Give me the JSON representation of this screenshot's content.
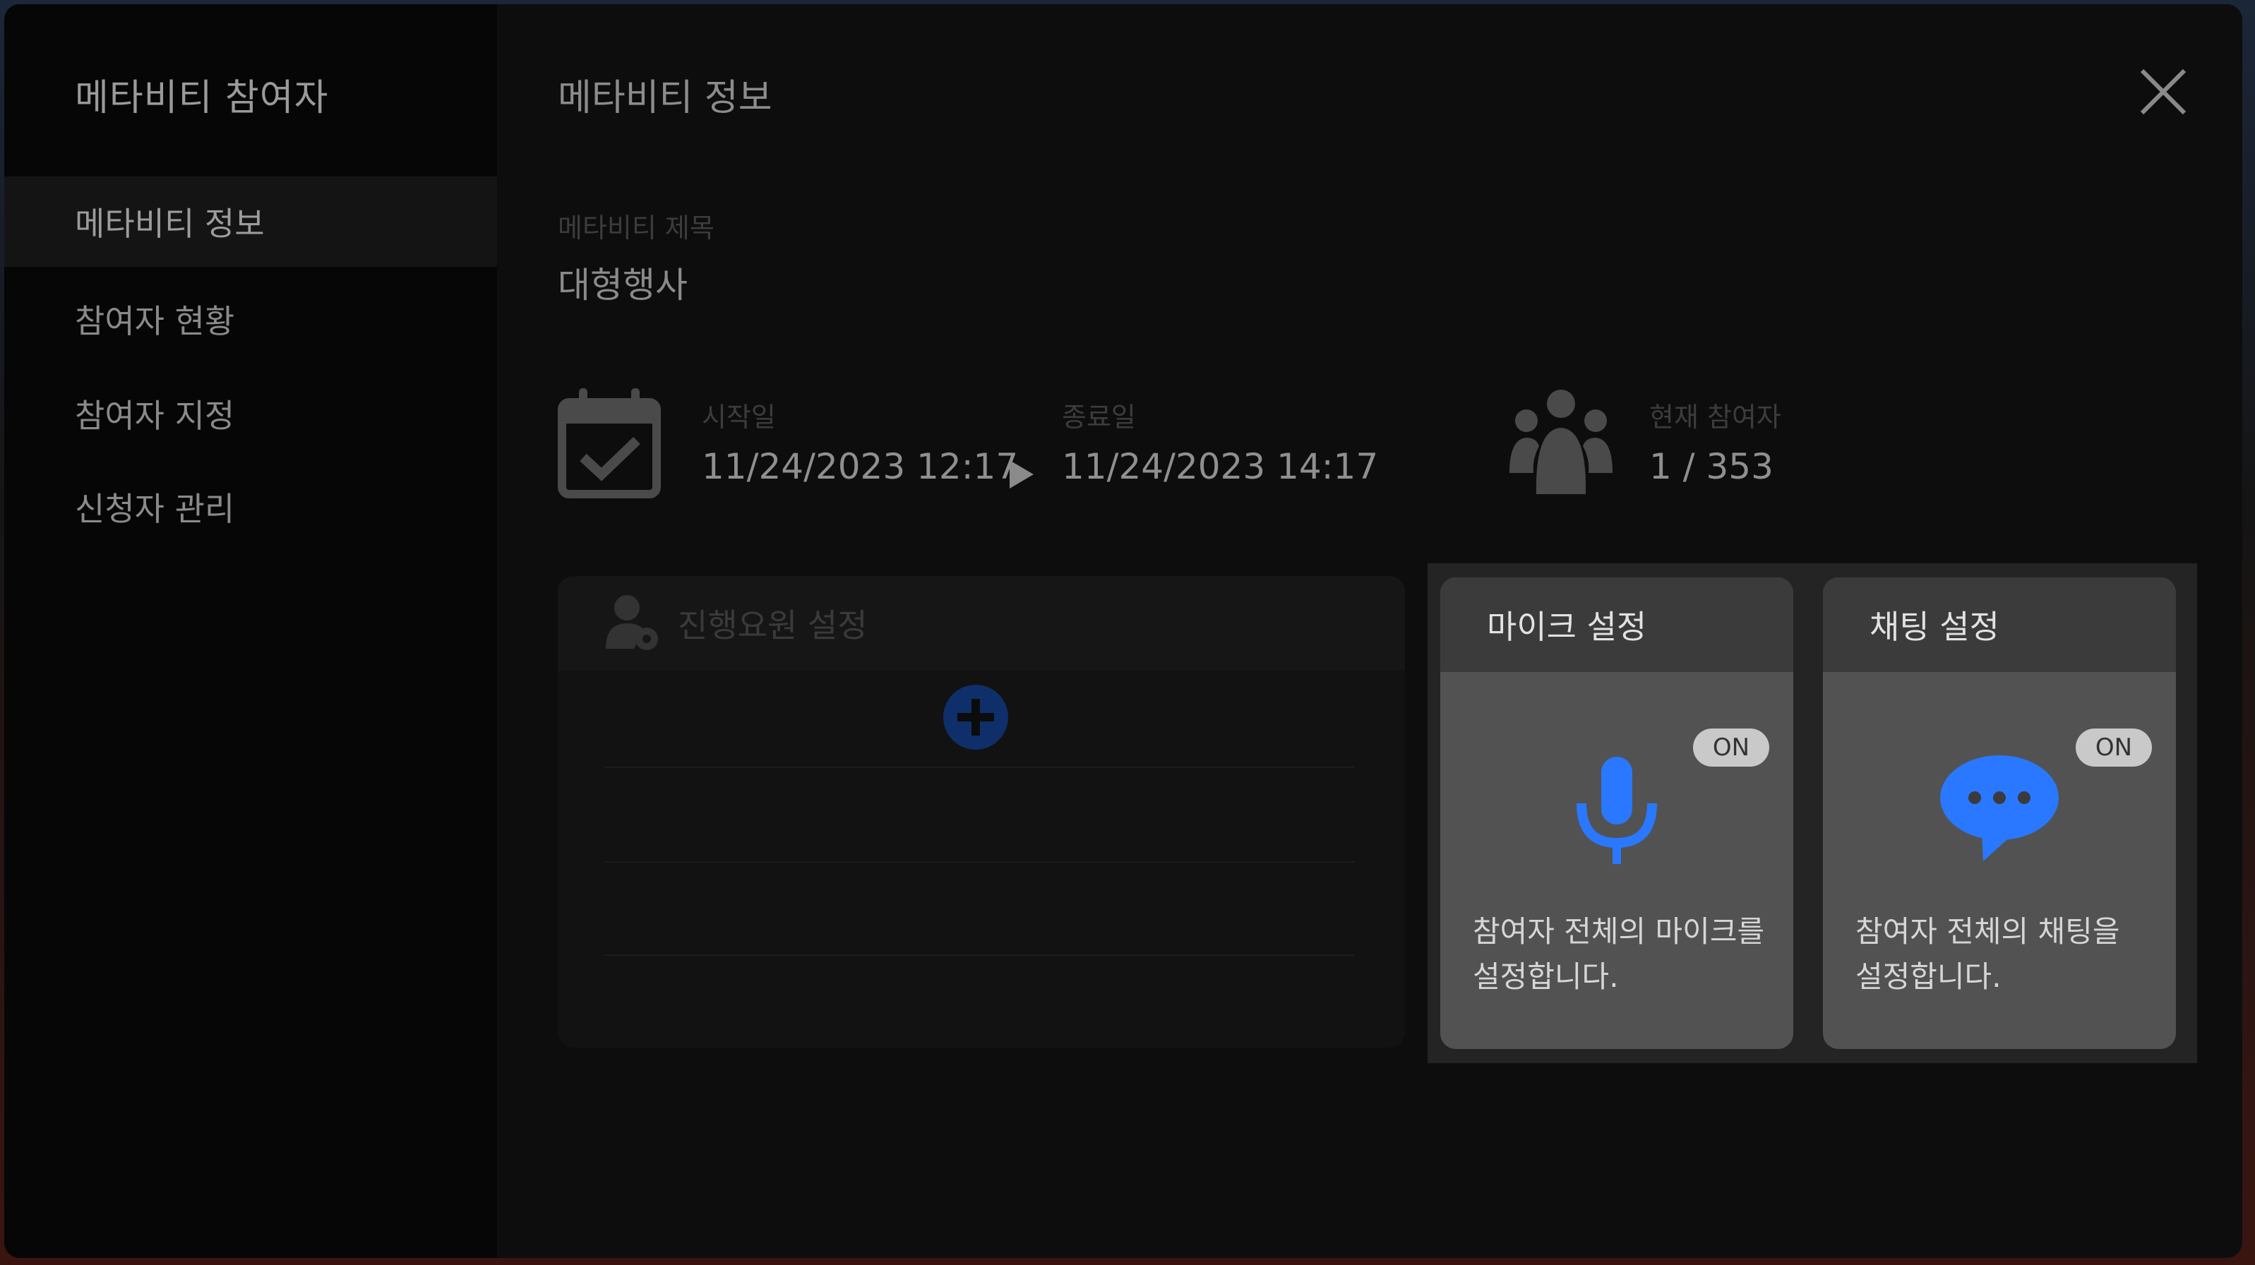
{
  "sidebar": {
    "title": "메타비티 참여자",
    "items": [
      {
        "label": "메타비티 정보",
        "active": true
      },
      {
        "label": "참여자 현황",
        "active": false
      },
      {
        "label": "참여자 지정",
        "active": false
      },
      {
        "label": "신청자 관리",
        "active": false
      }
    ]
  },
  "main": {
    "title": "메타비티 정보",
    "title_field": {
      "label": "메타비티 제목",
      "value": "대형행사"
    },
    "dates": {
      "start_label": "시작일",
      "start_value": "11/24/2023 12:17",
      "end_label": "종료일",
      "end_value": "11/24/2023 14:17",
      "icon": "calendar-check-icon"
    },
    "participants": {
      "label": "현재 참여자",
      "value": "1 / 353",
      "icon": "users-icon"
    },
    "staff_panel": {
      "label": "진행요원 설정",
      "icon": "user-gear-icon"
    },
    "mic_card": {
      "title": "마이크 설정",
      "badge": "ON",
      "description": "참여자 전체의 마이크를 설정합니다.",
      "icon": "microphone-icon"
    },
    "chat_card": {
      "title": "채팅 설정",
      "badge": "ON",
      "description": "참여자 전체의 채팅을 설정합니다.",
      "icon": "chat-bubble-icon"
    }
  },
  "colors": {
    "accent_blue": "#2a78ff",
    "card_bg": "#525252",
    "badge_bg": "#c9c9c9"
  }
}
